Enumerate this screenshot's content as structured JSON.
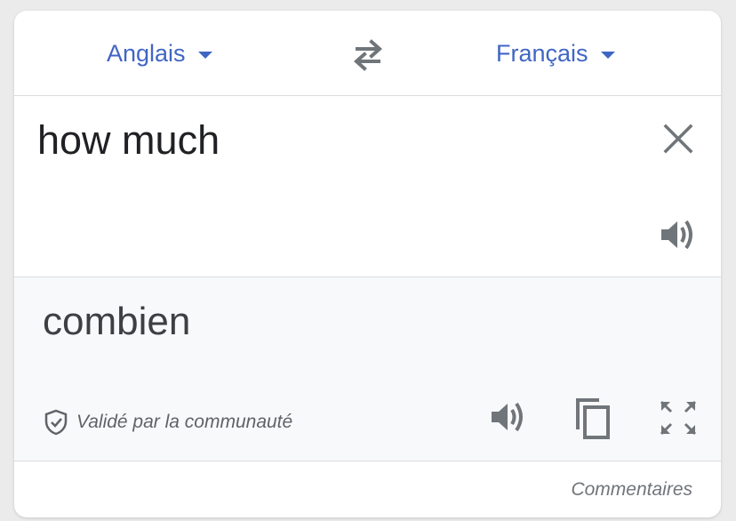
{
  "colors": {
    "accent": "#4066c4",
    "icon": "#70757a",
    "text": "#202124",
    "output_bg": "#f8f9fa"
  },
  "languages": {
    "source_label": "Anglais",
    "target_label": "Français"
  },
  "icons": {
    "swap": "swap-arrows-icon",
    "clear": "close-icon",
    "speak": "speaker-icon",
    "copy": "copy-icon",
    "expand": "fullscreen-icon",
    "verified": "shield-check-icon"
  },
  "input": {
    "text": "how much"
  },
  "output": {
    "text": "combien",
    "verified_label": "Validé par la communauté"
  },
  "footer": {
    "feedback_label": "Commentaires"
  }
}
